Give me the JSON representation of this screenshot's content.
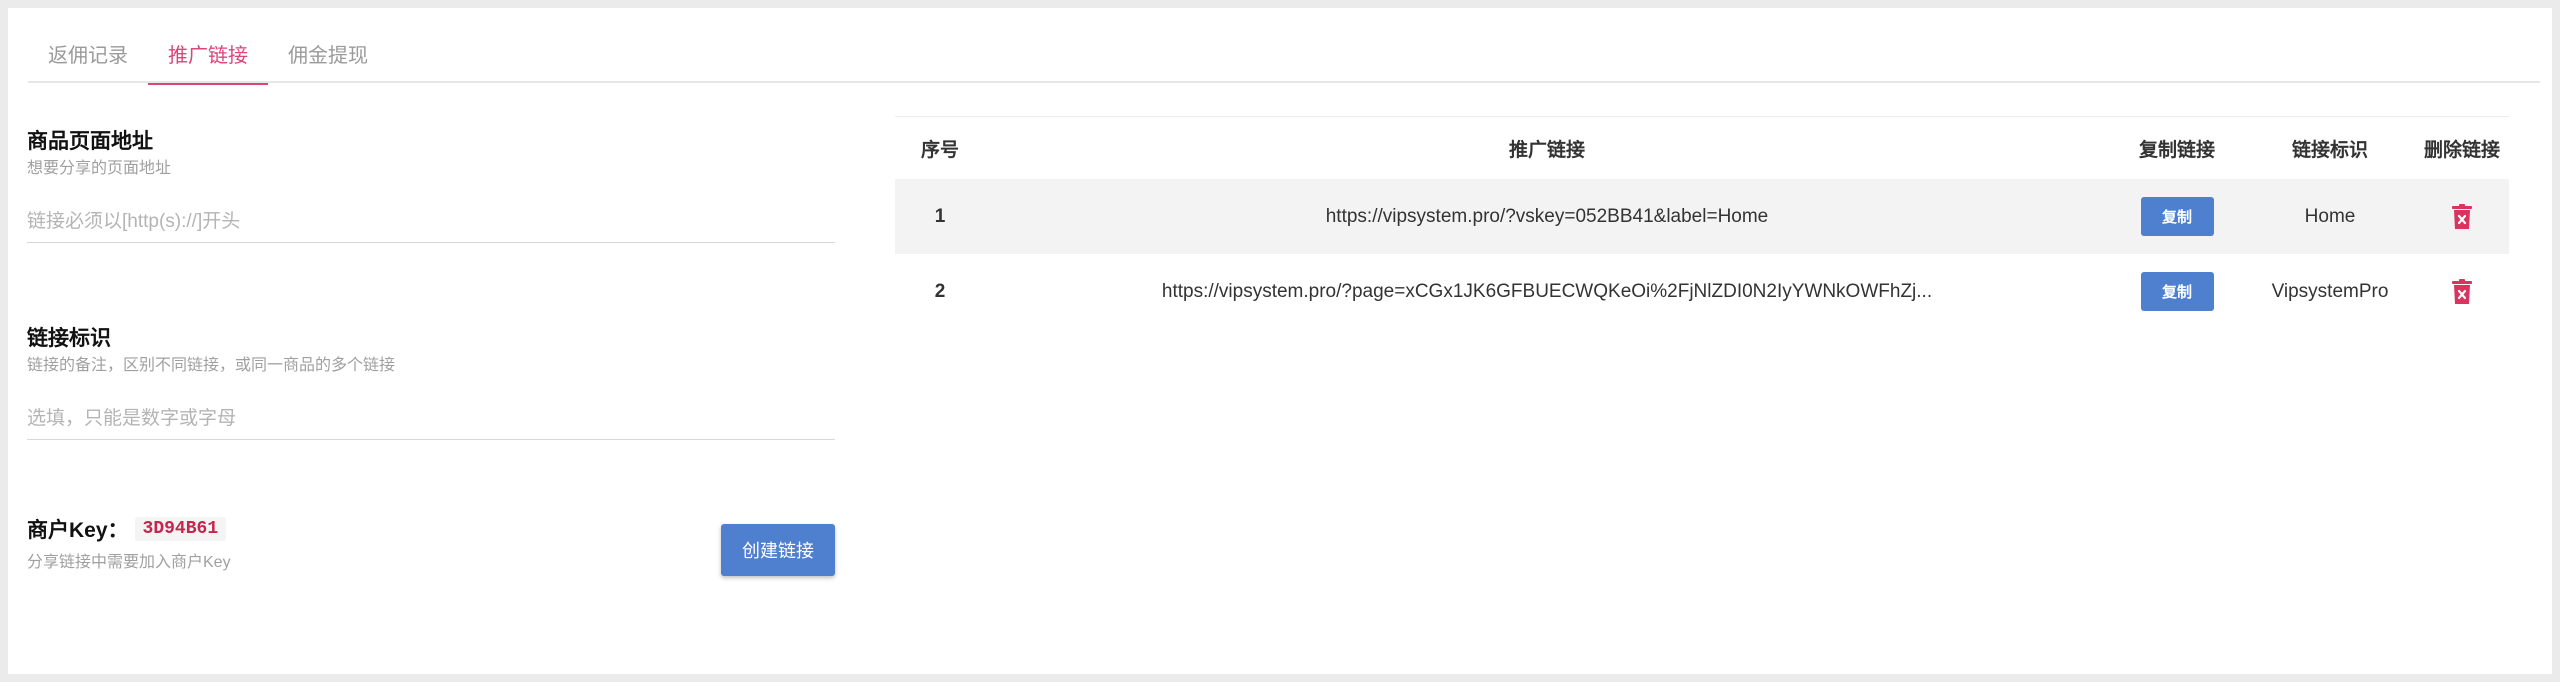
{
  "tabs": [
    {
      "label": "返佣记录",
      "active": false
    },
    {
      "label": "推广链接",
      "active": true
    },
    {
      "label": "佣金提现",
      "active": false
    }
  ],
  "form": {
    "url_field": {
      "title": "商品页面地址",
      "desc": "想要分享的页面地址",
      "placeholder": "链接必须以[http(s)://]开头",
      "value": ""
    },
    "label_field": {
      "title": "链接标识",
      "desc": "链接的备注，区别不同链接，或同一商品的多个链接",
      "placeholder": "选填，只能是数字或字母",
      "value": ""
    },
    "merchant": {
      "title": "商户Key：",
      "key": "3D94B61",
      "desc": "分享链接中需要加入商户Key"
    },
    "create_label": "创建链接"
  },
  "table": {
    "headers": [
      "序号",
      "推广链接",
      "复制链接",
      "链接标识",
      "删除链接"
    ],
    "rows": [
      {
        "no": "1",
        "link": "https://vipsystem.pro/?vskey=052BB41&label=Home",
        "copy": "复制",
        "label": "Home"
      },
      {
        "no": "2",
        "link": "https://vipsystem.pro/?page=xCGx1JK6GFBUECWQKeOi%2FjNlZDI0N2IyYWNkOWFhZj...",
        "copy": "复制",
        "label": "VipsystemPro"
      }
    ]
  },
  "colors": {
    "accent": "#d9467a",
    "primary_button": "#4f7fcf",
    "delete_icon": "#d9345e",
    "key_text": "#c7254e"
  }
}
